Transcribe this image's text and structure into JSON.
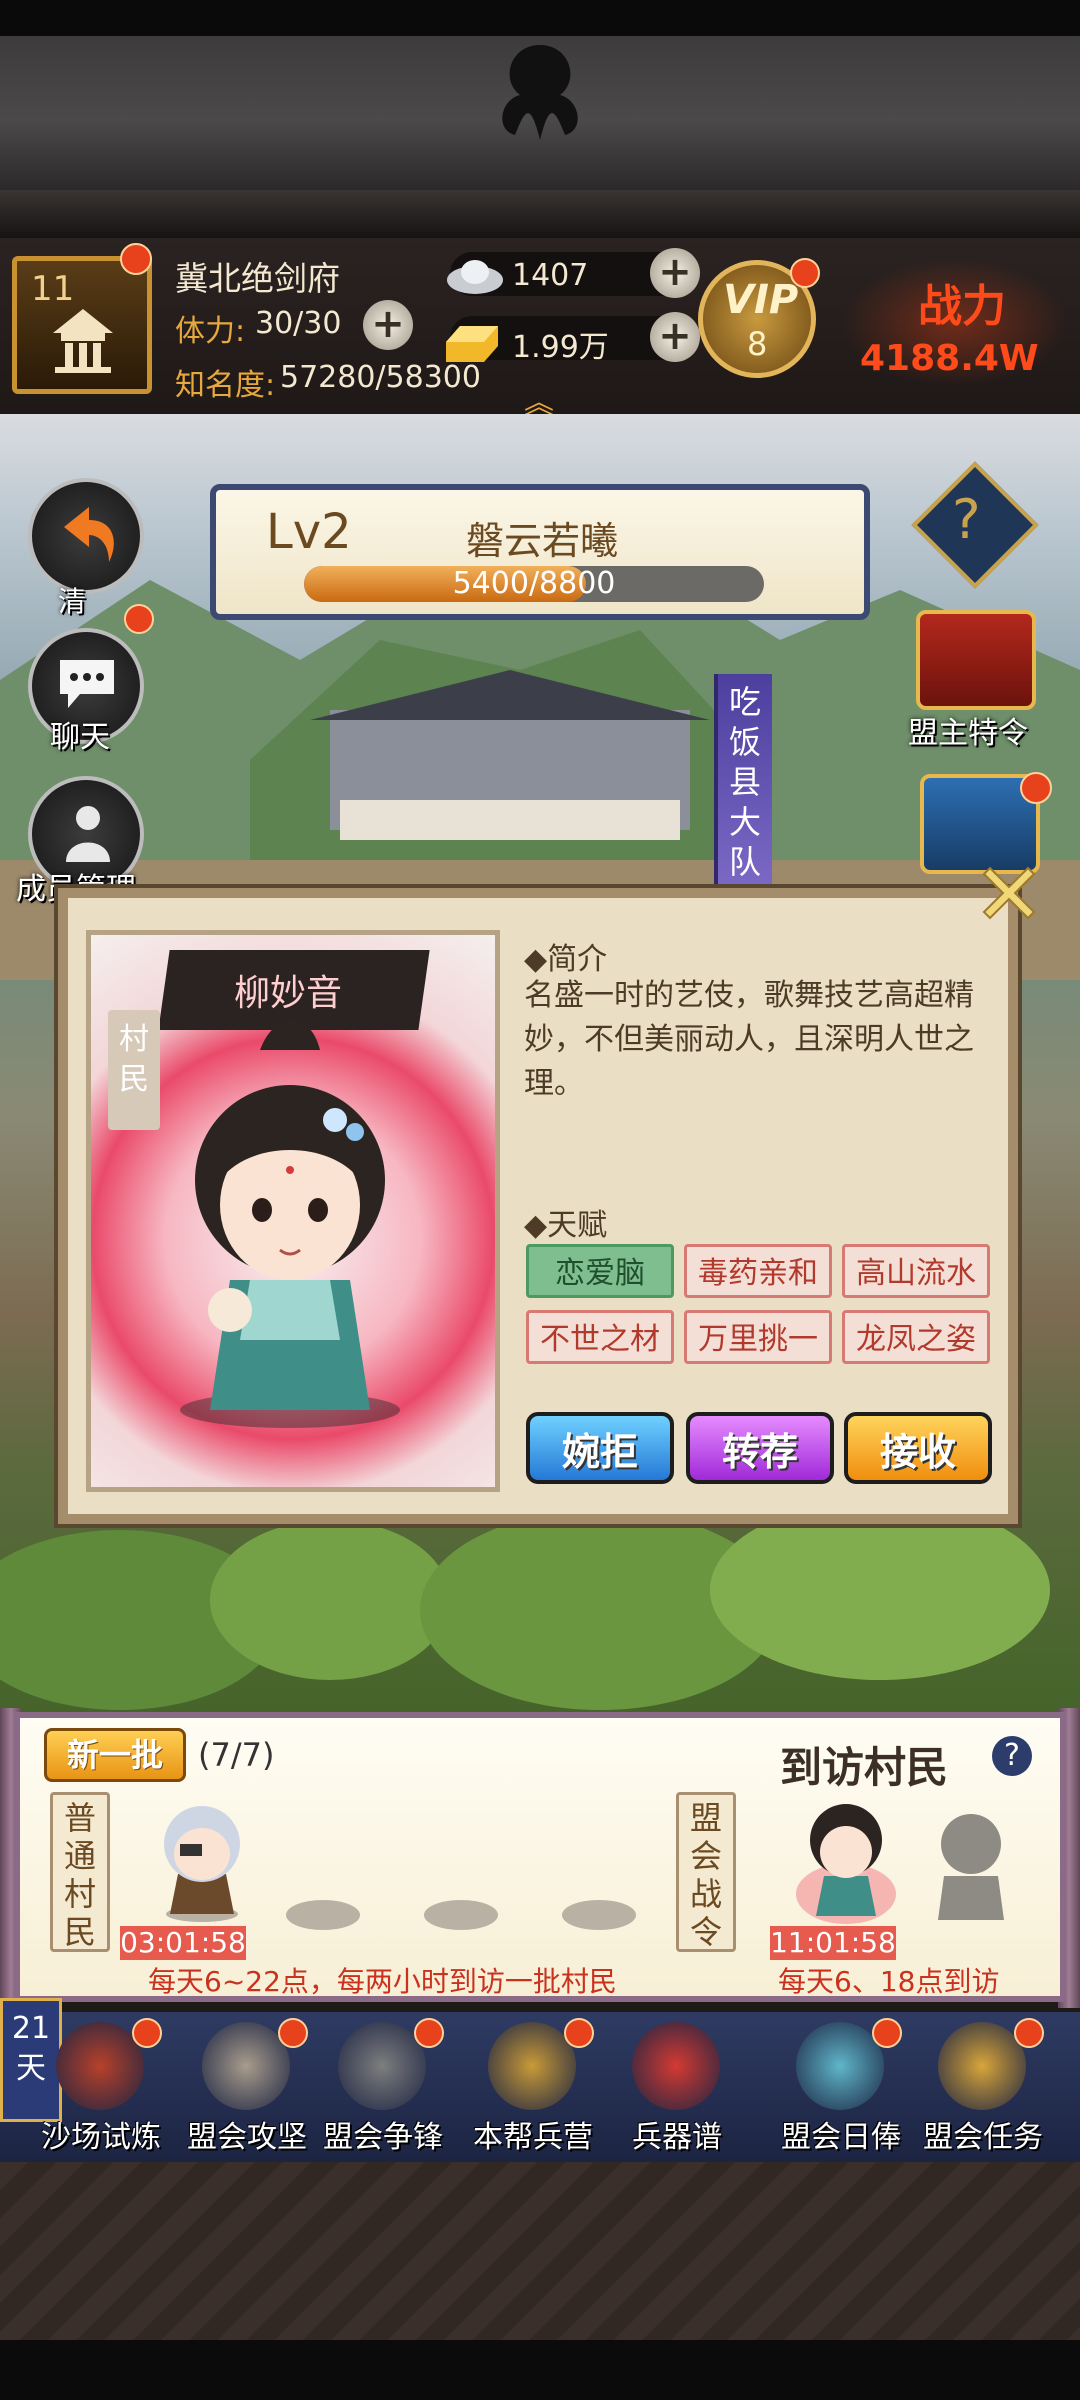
{
  "header": {
    "level": "11",
    "player_name": "冀北绝剑府",
    "stamina_label": "体力:",
    "stamina_value": "30/30",
    "fame_label": "知名度:",
    "fame_value": "57280/58300",
    "silver": "1407",
    "gold": "1.99万",
    "vip_text": "VIP",
    "vip_level": "8",
    "power_label": "战力",
    "power_value": "4188.4W"
  },
  "scene": {
    "banner_level": "Lv2",
    "banner_name": "磐云若曦",
    "exp_text": "5400/8800",
    "exp_progress": 0.614,
    "guild_name": "吃饭县大队",
    "side_left": [
      {
        "label": "清",
        "icon": "return-arrow-icon"
      },
      {
        "label": "聊天",
        "icon": "chat-bubble-icon"
      },
      {
        "label": "成员管理",
        "icon": "members-icon"
      }
    ],
    "side_right": [
      {
        "label": "?",
        "icon": "help-icon"
      },
      {
        "label": "盟主特令",
        "icon": "leader-chest-icon"
      }
    ]
  },
  "popup": {
    "character_name": "柳妙音",
    "ribbon_text": "村民",
    "intro_heading": "◆简介",
    "intro_text": "名盛一时的艺伎，歌舞技艺高超精妙，不但美丽动人，且深明人世之理。",
    "talent_heading": "◆天赋",
    "talents": [
      "恋爱脑",
      "毒药亲和",
      "高山流水",
      "不世之材",
      "万里挑一",
      "龙凤之姿"
    ],
    "decline_label": "婉拒",
    "recommend_label": "转荐",
    "accept_label": "接收"
  },
  "visitors": {
    "new_batch_label": "新一批",
    "batch_count": "(7/7)",
    "title": "到访村民",
    "help": "?",
    "common_label": "普通村民",
    "league_label": "盟会战令",
    "timer_common": "03:01:58",
    "timer_league": "11:01:58",
    "schedule_common": "每天6~22点，每两小时到访一批村民",
    "schedule_league": "每天6、18点到访"
  },
  "bottom_nav": {
    "days": "21天",
    "items": [
      {
        "label": "沙场试炼",
        "icon": "trial-icon",
        "color": "#b8412a"
      },
      {
        "label": "盟会攻坚",
        "icon": "hammer-icon",
        "color": "#a89c8c"
      },
      {
        "label": "盟会争锋",
        "icon": "gong-icon",
        "color": "#7e7e7e"
      },
      {
        "label": "本帮兵营",
        "icon": "helmet-icon",
        "color": "#c99a38"
      },
      {
        "label": "兵器谱",
        "icon": "book-icon",
        "color": "#d43a32"
      },
      {
        "label": "盟会日俸",
        "icon": "money-tree-icon",
        "color": "#5fb6c9"
      },
      {
        "label": "盟会任务",
        "icon": "scroll-icon",
        "color": "#d8a53a"
      }
    ]
  }
}
